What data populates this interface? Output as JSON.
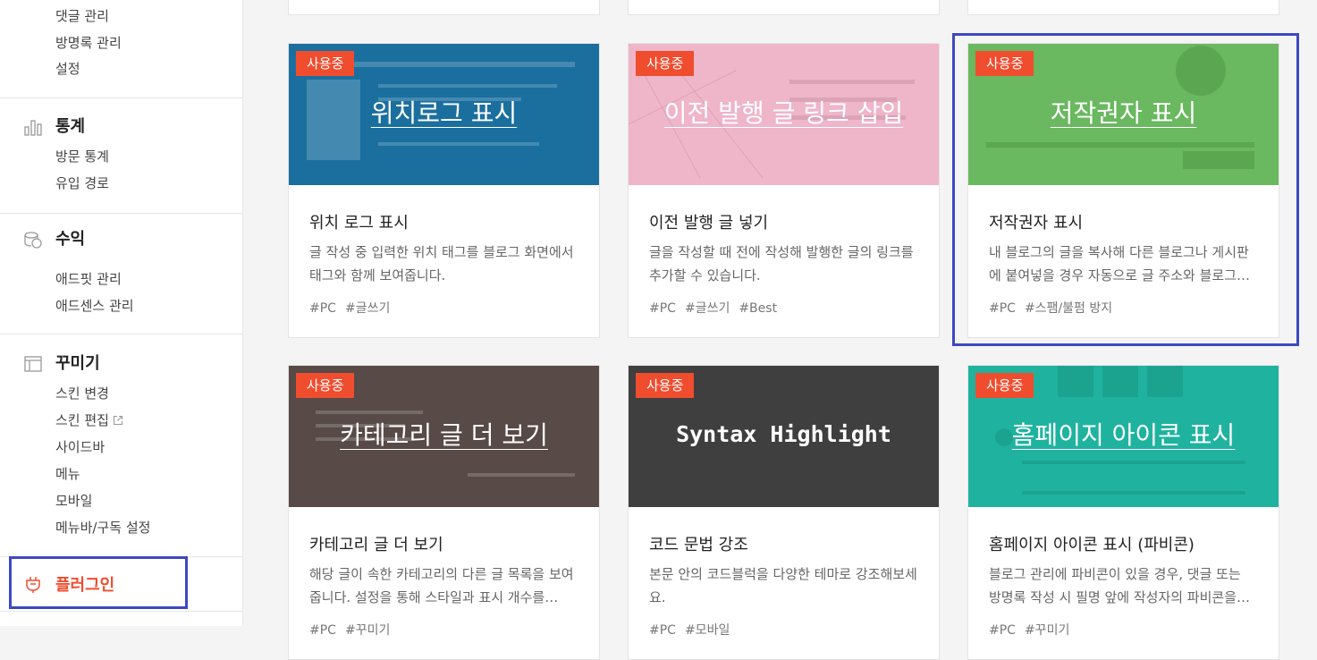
{
  "sidebar": {
    "top_items": [
      "댓글 관리",
      "방명록 관리",
      "설정"
    ],
    "stats": {
      "title": "통계",
      "icon": "bar-chart-icon",
      "items": [
        "방문 통계",
        "유입 경로"
      ]
    },
    "revenue": {
      "title": "수익",
      "icon": "coins-icon",
      "items": [
        "애드핏 관리",
        "애드센스 관리"
      ]
    },
    "design": {
      "title": "꾸미기",
      "icon": "layout-icon",
      "items": [
        "스킨 변경",
        "스킨 편집",
        "사이드바",
        "메뉴",
        "모바일",
        "메뉴바/구독 설정"
      ]
    },
    "plugin": {
      "title": "플러그인",
      "icon": "plug-icon",
      "color": "#f04d2f"
    }
  },
  "cards": [
    {
      "badge": "사용중",
      "thumb_title": "위치로그 표시",
      "thumb_color": "#1b6f9f",
      "title": "위치 로그 표시",
      "desc": "글 작성 중 입력한 위치 태그를 블로그 화면에서 태그와 함께 보여줍니다.",
      "tags": [
        "#PC",
        "#글쓰기"
      ]
    },
    {
      "badge": "사용중",
      "thumb_title": "이전 발행 글 링크 삽입",
      "thumb_color": "#efb5c9",
      "title": "이전 발행 글 넣기",
      "desc": "글을 작성할 때 전에 작성해 발행한 글의 링크를 추가할 수 있습니다.",
      "tags": [
        "#PC",
        "#글쓰기",
        "#Best"
      ]
    },
    {
      "badge": "사용중",
      "thumb_title": "저작권자 표시",
      "thumb_color": "#6ab85f",
      "title": "저작권자 표시",
      "desc": "내 블로그의 글을 복사해 다른 블로그나 게시판에 붙여넣을 경우 자동으로 글 주소와 블로그…",
      "tags": [
        "#PC",
        "#스팸/불펌 방지"
      ]
    },
    {
      "badge": "사용중",
      "thumb_title": "카테고리 글 더 보기",
      "thumb_color": "#574a47",
      "title": "카테고리 글 더 보기",
      "desc": "해당 글이 속한 카테고리의 다른 글 목록을 보여줍니다. 설정을 통해 스타일과 표시 개수를…",
      "tags": [
        "#PC",
        "#꾸미기"
      ]
    },
    {
      "badge": "사용중",
      "thumb_title": "Syntax Highlight",
      "thumb_color": "#3f3f3f",
      "title": "코드 문법 강조",
      "desc": "본문 안의 코드블럭을 다양한 테마로 강조해보세요.",
      "tags": [
        "#PC",
        "#모바일"
      ]
    },
    {
      "badge": "사용중",
      "thumb_title": "홈페이지 아이콘 표시",
      "thumb_color": "#1fb39f",
      "title": "홈페이지 아이콘 표시 (파비콘)",
      "desc": "블로그 관리에 파비콘이 있을 경우, 댓글 또는 방명록 작성 시 필명 앞에 작성자의 파비콘을…",
      "tags": [
        "#PC",
        "#꾸미기"
      ]
    }
  ],
  "colors": {
    "accent": "#f04d2f",
    "selection": "#3d48c0"
  }
}
